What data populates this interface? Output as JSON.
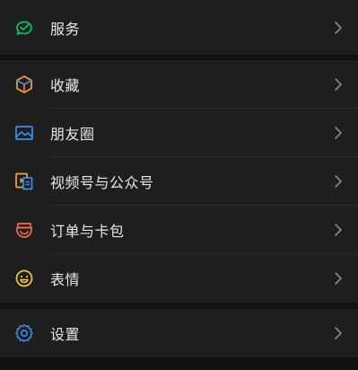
{
  "colors": {
    "page_bg": "#111111",
    "cell_bg": "#1e1e1e",
    "text": "#e8e8e8",
    "chevron": "#8a8a8a",
    "services_icon": "#07c160",
    "favorites_icon": "#f0a93b",
    "moments_icon": "#3b8ff2",
    "channels_icon": "#f0a93b",
    "orders_icon": "#fa6a4b",
    "sticker_icon": "#f6c33b",
    "settings_icon": "#3b8ff2"
  },
  "menu": {
    "services": {
      "label": "服务",
      "icon": "wechat-pay-icon"
    },
    "favorites": {
      "label": "收藏",
      "icon": "cube-icon"
    },
    "moments": {
      "label": "朋友圈",
      "icon": "image-icon"
    },
    "channels": {
      "label": "视频号与公众号",
      "icon": "video-doc-icon"
    },
    "orders": {
      "label": "订单与卡包",
      "icon": "wallet-icon"
    },
    "stickers": {
      "label": "表情",
      "icon": "smile-icon"
    },
    "settings": {
      "label": "设置",
      "icon": "gear-icon"
    }
  }
}
